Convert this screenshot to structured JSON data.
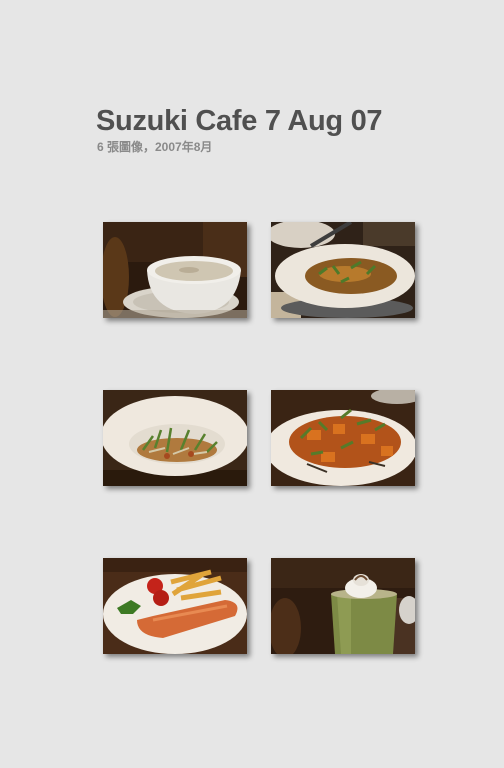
{
  "album": {
    "title": "Suzuki Cafe 7 Aug 07",
    "subtitle": "6 張圖像，2007年8月"
  },
  "photos": [
    {
      "subject": "soup-bowl"
    },
    {
      "subject": "salad-plate"
    },
    {
      "subject": "sprout-salad"
    },
    {
      "subject": "pumpkin-salad"
    },
    {
      "subject": "salmon-fries"
    },
    {
      "subject": "matcha-drink"
    }
  ]
}
